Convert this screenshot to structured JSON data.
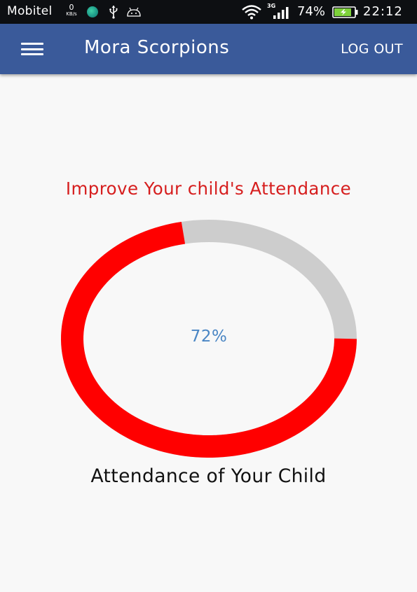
{
  "status_bar": {
    "carrier": "Mobitel",
    "net_speed_value": "0",
    "net_speed_unit": "KB/s",
    "network_type": "3G",
    "battery_percent": "74%",
    "time": "22:12",
    "icons": [
      "globe-icon",
      "usb-icon",
      "android-icon",
      "wifi-icon",
      "signal-icon",
      "battery-charging-icon"
    ]
  },
  "app_bar": {
    "menu_icon": "hamburger-menu-icon",
    "title": "Mora Scorpions",
    "logout_label": "LOG OUT"
  },
  "main": {
    "headline": "Improve Your child's Attendance",
    "attendance": {
      "percent_label": "72%",
      "value": 0.72,
      "caption": "Attendance of Your Child"
    }
  },
  "colors": {
    "app_bar": "#3a5a9a",
    "headline": "#d61e1e",
    "ring_progress": "#ff0000",
    "ring_track": "#cdcdcd",
    "percent_text": "#4a86c4",
    "background": "#f8f8f8"
  }
}
